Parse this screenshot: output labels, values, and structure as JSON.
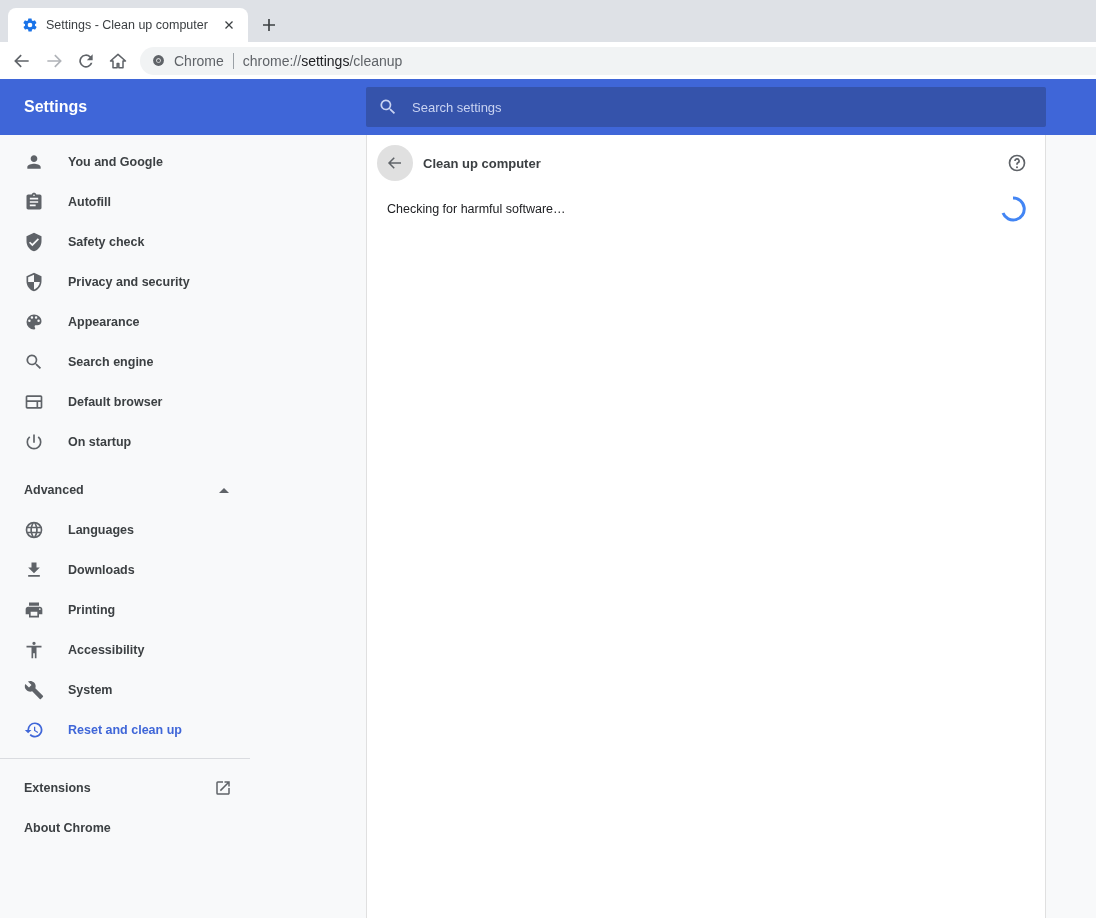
{
  "tab": {
    "title": "Settings - Clean up computer"
  },
  "address_bar": {
    "site_label": "Chrome",
    "url_scheme": "chrome://",
    "url_host": "settings",
    "url_path": "/cleanup"
  },
  "header": {
    "title": "Settings",
    "search": {
      "placeholder": "Search settings"
    }
  },
  "sidebar": {
    "items": [
      {
        "label": "You and Google",
        "selected": false
      },
      {
        "label": "Autofill",
        "selected": false
      },
      {
        "label": "Safety check",
        "selected": false
      },
      {
        "label": "Privacy and security",
        "selected": false
      },
      {
        "label": "Appearance",
        "selected": false
      },
      {
        "label": "Search engine",
        "selected": false
      },
      {
        "label": "Default browser",
        "selected": false
      },
      {
        "label": "On startup",
        "selected": false
      }
    ],
    "advanced": {
      "label": "Advanced",
      "expanded": true,
      "items": [
        {
          "label": "Languages",
          "selected": false
        },
        {
          "label": "Downloads",
          "selected": false
        },
        {
          "label": "Printing",
          "selected": false
        },
        {
          "label": "Accessibility",
          "selected": false
        },
        {
          "label": "System",
          "selected": false
        },
        {
          "label": "Reset and clean up",
          "selected": true
        }
      ]
    },
    "links": [
      "Extensions",
      "About Chrome"
    ]
  },
  "page": {
    "title": "Clean up computer",
    "status": "Checking for harmful software…"
  }
}
